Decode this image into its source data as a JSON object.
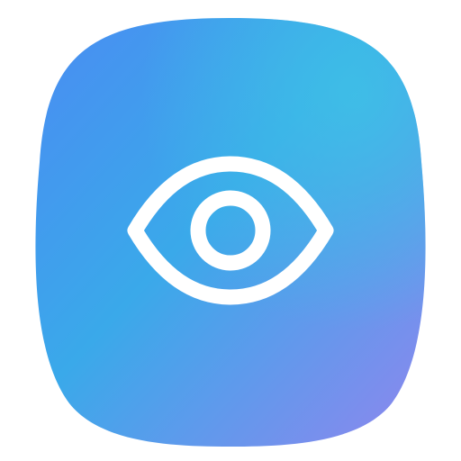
{
  "icon": {
    "name": "eye-icon",
    "background": "#ffffff",
    "gradient": {
      "top_left": "#4A8CF2",
      "top_right": "#3EC1E6",
      "middle": "#3AA9EA",
      "bottom_right": "#8F86EE"
    },
    "glyph_color": "#ffffff"
  }
}
